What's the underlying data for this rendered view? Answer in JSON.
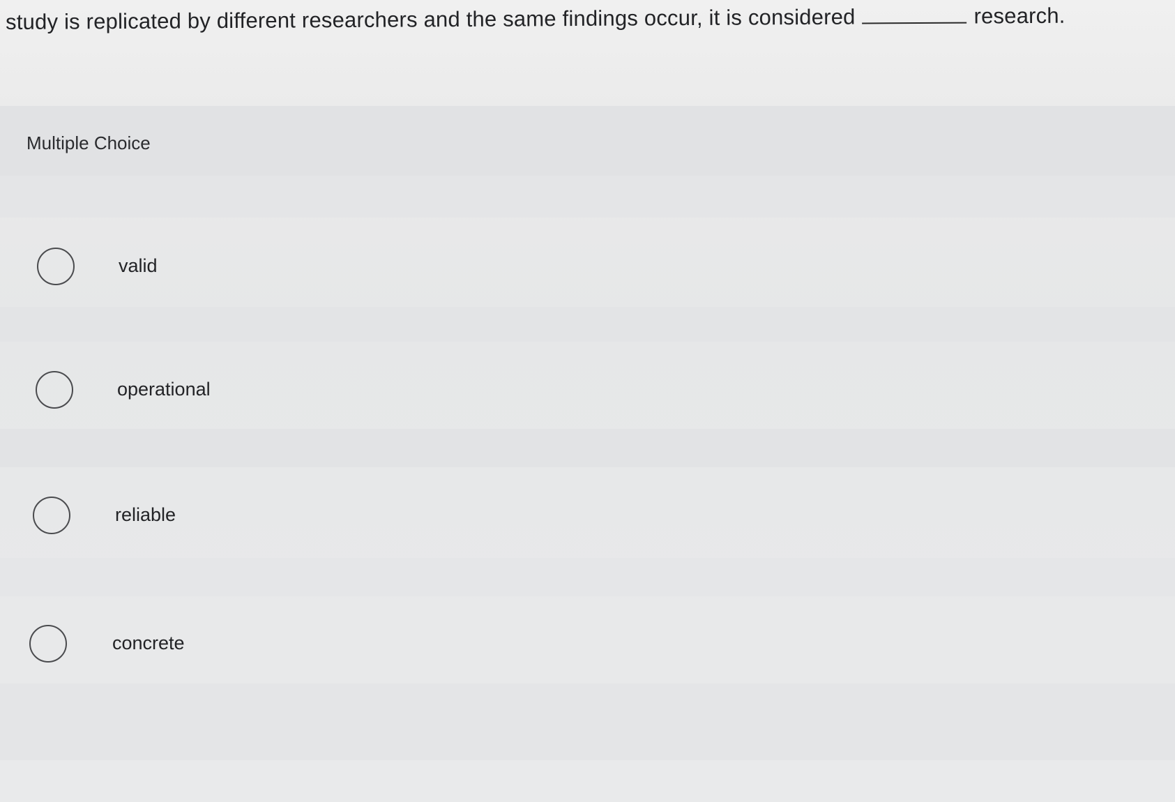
{
  "question": {
    "text_before": "study is replicated by different researchers and the same findings occur, it is considered",
    "text_after": "research."
  },
  "section": {
    "label": "Multiple Choice"
  },
  "choices": [
    {
      "label": "valid"
    },
    {
      "label": "operational"
    },
    {
      "label": "reliable"
    },
    {
      "label": "concrete"
    }
  ]
}
